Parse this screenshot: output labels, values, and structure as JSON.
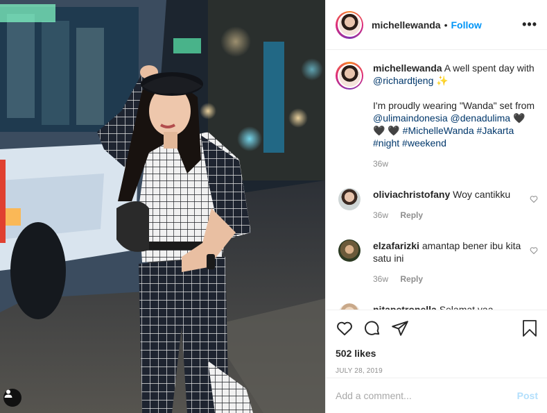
{
  "header": {
    "username": "michellewanda",
    "separator": "•",
    "follow_label": "Follow",
    "more_label": "•••"
  },
  "caption": {
    "username": "michellewanda",
    "text_1": "A well spent day with",
    "mention_1": "@richardtjeng",
    "emoji_1": "✨",
    "text_2": "I'm proudly wearing \"Wanda\" set from",
    "mention_2": "@ulimaindonesia",
    "mention_3": "@denadulima",
    "hearts": "🖤 🖤",
    "heart_3": "🖤",
    "hashtag_1": "#MichelleWanda",
    "hashtag_2": "#Jakarta",
    "hashtag_3": "#night",
    "hashtag_4": "#weekend",
    "age": "36w"
  },
  "comments": [
    {
      "username": "oliviachristofany",
      "text": "Woy cantikku",
      "age": "36w",
      "reply_label": "Reply"
    },
    {
      "username": "elzafarizki",
      "text": "amantap bener ibu kita satu ini",
      "age": "36w",
      "reply_label": "Reply"
    },
    {
      "username": "nitapetronella",
      "text": "Selamat yaa",
      "age": "",
      "reply_label": ""
    }
  ],
  "post": {
    "likes": "502 likes",
    "date": "JULY 28, 2019"
  },
  "add_comment": {
    "placeholder": "Add a comment...",
    "post_label": "Post"
  },
  "colors": {
    "accent": "#0095f6",
    "mention": "#00376b",
    "muted": "#8e8e8e",
    "post_disabled": "#b2dffc"
  },
  "icons": [
    "heart-icon",
    "comment-icon",
    "share-icon",
    "bookmark-icon",
    "user-tag-icon",
    "more-icon"
  ]
}
